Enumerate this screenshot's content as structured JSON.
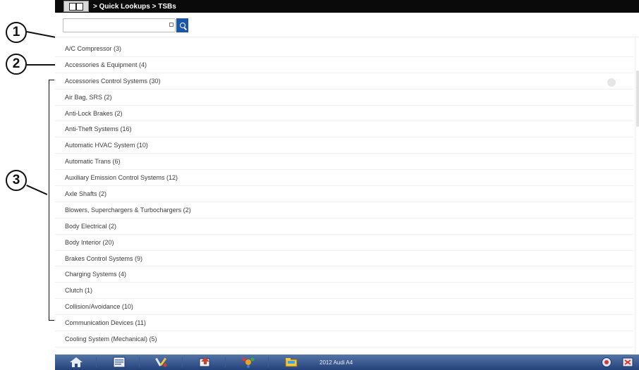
{
  "callouts": [
    "1",
    "2",
    "3"
  ],
  "header": {
    "breadcrumb": "> Quick Lookups > TSBs"
  },
  "search": {
    "value": "",
    "placeholder": ""
  },
  "list": {
    "items": [
      "A/C Compressor (3)",
      "Accessories & Equipment (4)",
      "Accessories Control Systems (30)",
      "Air Bag, SRS (2)",
      "Anti-Lock Brakes (2)",
      "Anti-Theft Systems (16)",
      "Automatic HVAC System (10)",
      "Automatic Trans (6)",
      "Auxiliary Emission Control Systems (12)",
      "Axle Shafts (2)",
      "Blowers, Superchargers & Turbochargers (2)",
      "Body Electrical (2)",
      "Body Interior (20)",
      "Brakes Control Systems (9)",
      "Charging Systems (4)",
      "Clutch (1)",
      "Collision/Avoidance (10)",
      "Communication Devices (11)",
      "Cooling System (Mechanical) (5)"
    ]
  },
  "taskbar": {
    "vehicle": "2012 Audi A4",
    "icons": [
      "home-icon",
      "list-icon",
      "tools-icon",
      "data-icon",
      "network-icon",
      "folder-icon",
      "help-icon",
      "exit-icon"
    ]
  },
  "colors": {
    "titlebar": "#0a0a0a",
    "search_button": "#1b57a6",
    "taskbar_top": "#5575a8",
    "taskbar_bottom": "#24427a"
  }
}
